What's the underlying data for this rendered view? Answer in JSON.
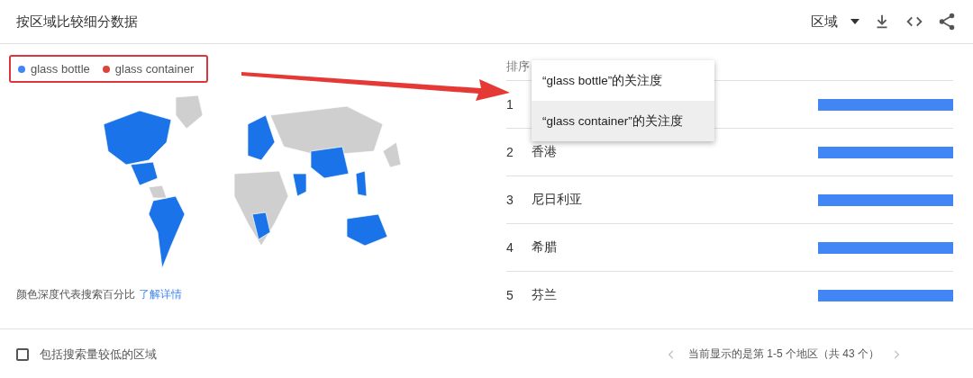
{
  "header": {
    "title": "按区域比较细分数据",
    "region_select": "区域"
  },
  "legend": [
    {
      "label": "glass bottle",
      "color": "#4285f4"
    },
    {
      "label": "glass container",
      "color": "#db4437"
    }
  ],
  "map_note": {
    "text": "颜色深度代表搜索百分比",
    "link": "了解详情"
  },
  "table": {
    "column_1": "排序",
    "rows": [
      {
        "rank": "1",
        "name": "",
        "level": 1
      },
      {
        "rank": "2",
        "name": "香港",
        "level": 1
      },
      {
        "rank": "3",
        "name": "尼日利亚",
        "level": 1
      },
      {
        "rank": "4",
        "name": "希腊",
        "level": 1
      },
      {
        "rank": "5",
        "name": "芬兰",
        "level": 1
      }
    ]
  },
  "menu": {
    "items": [
      {
        "label": "“glass bottle”的关注度",
        "selected": false
      },
      {
        "label": "“glass container”的关注度",
        "selected": true
      }
    ]
  },
  "footer": {
    "checkbox": {
      "label": "包括搜索量较低的区域",
      "checked": false
    },
    "pagination": "当前显示的是第 1-5 个地区（共 43 个）"
  }
}
